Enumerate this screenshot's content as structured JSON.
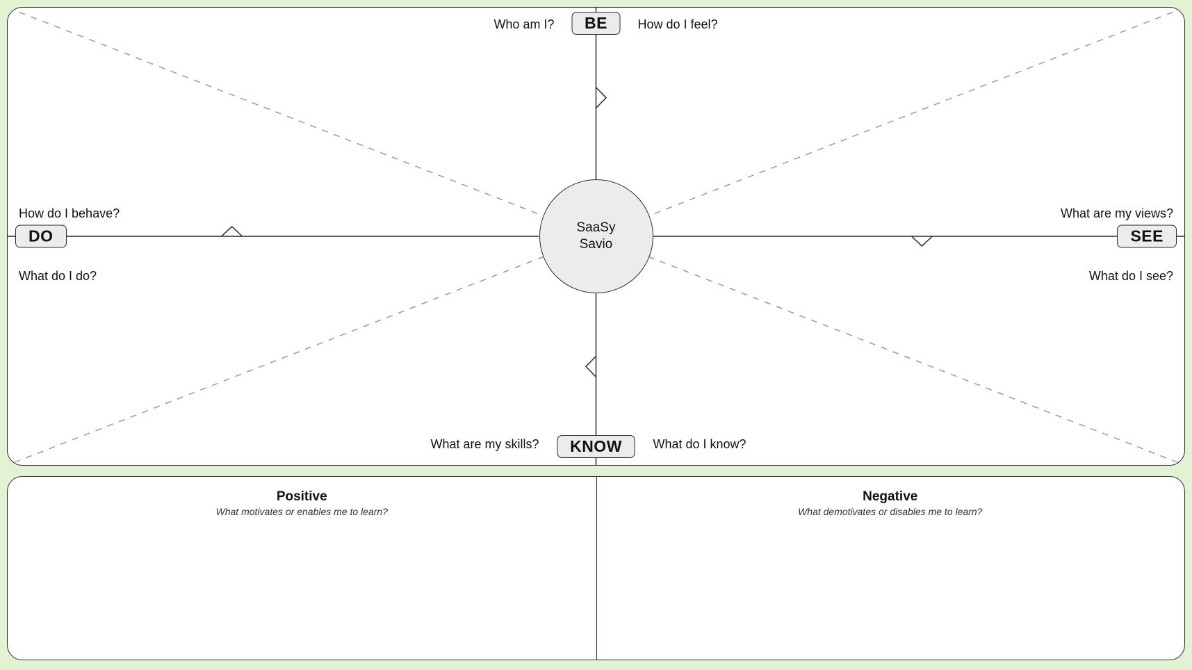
{
  "center": {
    "line1": "SaaSy",
    "line2": "Savio"
  },
  "axes": {
    "top": {
      "label": "BE",
      "question_left": "Who am I?",
      "question_right": "How do I feel?"
    },
    "bottom": {
      "label": "KNOW",
      "question_left": "What are my skills?",
      "question_right": "What do I know?"
    },
    "left": {
      "label": "DO",
      "question_top": "How do I behave?",
      "question_bottom": "What do I do?"
    },
    "right": {
      "label": "SEE",
      "question_top": "What are my views?",
      "question_bottom": "What do I see?"
    }
  },
  "bottom_panel": {
    "positive": {
      "title": "Positive",
      "subtitle": "What motivates or enables me to learn?"
    },
    "negative": {
      "title": "Negative",
      "subtitle": "What demotivates or disables me to learn?"
    }
  }
}
